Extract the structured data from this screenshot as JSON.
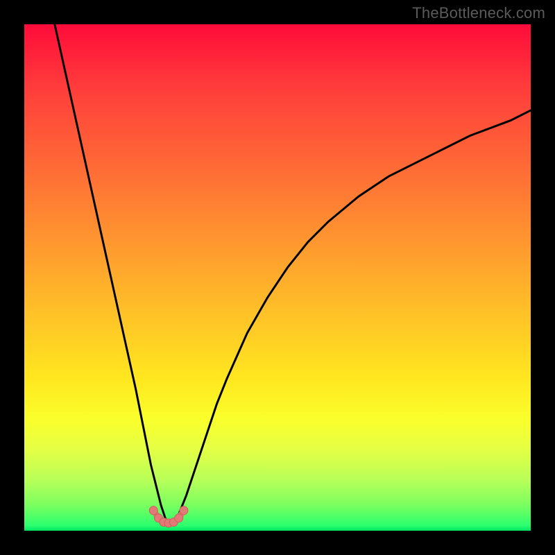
{
  "watermark": "TheBottleneck.com",
  "chart_data": {
    "type": "line",
    "title": "",
    "xlabel": "",
    "ylabel": "",
    "xlim": [
      0,
      100
    ],
    "ylim": [
      0,
      100
    ],
    "curve_left": {
      "name": "left-branch",
      "x": [
        6,
        8,
        10,
        12,
        14,
        16,
        18,
        20,
        22,
        23,
        24,
        25,
        26,
        27,
        28
      ],
      "y": [
        100,
        91,
        82,
        73,
        64,
        55,
        46,
        37,
        28,
        23,
        18,
        13,
        9,
        5,
        2
      ]
    },
    "curve_right": {
      "name": "right-branch",
      "x": [
        30,
        32,
        34,
        36,
        38,
        40,
        44,
        48,
        52,
        56,
        60,
        66,
        72,
        80,
        88,
        96,
        100
      ],
      "y": [
        2,
        7,
        13,
        19,
        25,
        30,
        39,
        46,
        52,
        57,
        61,
        66,
        70,
        74,
        78,
        81,
        83
      ]
    },
    "valley_markers": {
      "name": "valley-markers",
      "x": [
        25.5,
        26.5,
        27.5,
        28.5,
        29.5,
        30.5,
        31.5
      ],
      "y": [
        4.0,
        2.5,
        1.7,
        1.5,
        1.7,
        2.5,
        4.0
      ]
    },
    "colors": {
      "curve": "#000000",
      "marker_fill": "#e27a78",
      "marker_stroke": "#cc5f59"
    }
  }
}
